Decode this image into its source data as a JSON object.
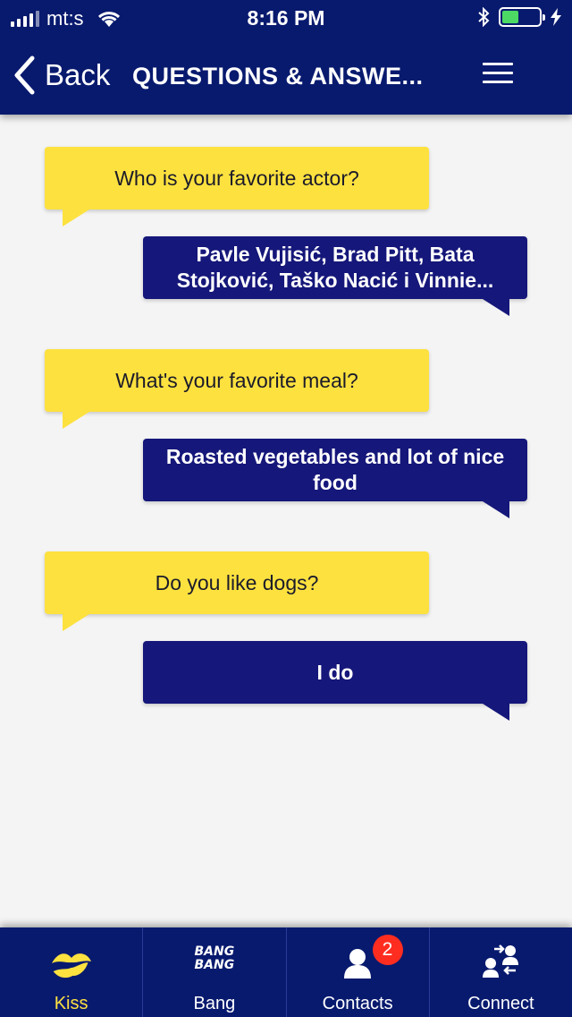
{
  "status_bar": {
    "carrier": "mt:s",
    "time": "8:16 PM",
    "battery_level": 0.45
  },
  "nav": {
    "back_label": "Back",
    "title": "QUESTIONS & ANSWE..."
  },
  "qa": [
    {
      "question": "Who is your favorite actor?",
      "answer": "Pavle Vujisić, Brad Pitt, Bata Stojković, Taško Nacić i Vinnie..."
    },
    {
      "question": "What's your favorite meal?",
      "answer": "Roasted vegetables and lot of nice food"
    },
    {
      "question": "Do you like dogs?",
      "answer": "I do"
    }
  ],
  "tabs": [
    {
      "label": "Kiss",
      "icon": "kiss-icon",
      "active": true
    },
    {
      "label": "Bang",
      "icon": "bang-icon",
      "icon_text": "BANG BANG"
    },
    {
      "label": "Contacts",
      "icon": "contacts-icon",
      "badge": "2"
    },
    {
      "label": "Connect",
      "icon": "connect-icon"
    }
  ],
  "colors": {
    "navy": "#081a6e",
    "answer_bubble": "#15177a",
    "question_bubble": "#fde13f",
    "accent": "#fde13f",
    "badge": "#ff2d20"
  }
}
